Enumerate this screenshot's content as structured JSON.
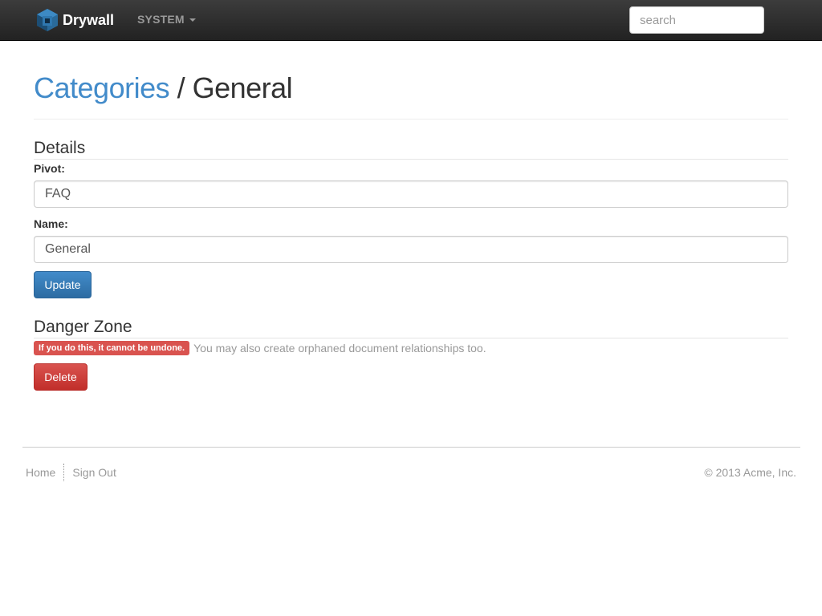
{
  "navbar": {
    "brand": "Drywall",
    "system_menu": "SYSTEM",
    "search_placeholder": "search"
  },
  "header": {
    "breadcrumb_link": "Categories",
    "separator": " / ",
    "current": "General"
  },
  "details": {
    "title": "Details",
    "pivot_label": "Pivot:",
    "pivot_value": "FAQ",
    "name_label": "Name:",
    "name_value": "General",
    "update_button": "Update"
  },
  "danger_zone": {
    "title": "Danger Zone",
    "warning_badge": "If you do this, it cannot be undone.",
    "warning_help": "You may also create orphaned document relationships too.",
    "delete_button": "Delete"
  },
  "footer": {
    "links": [
      "Home",
      "Sign Out"
    ],
    "copyright": "© 2013 Acme, Inc."
  },
  "colors": {
    "link": "#428bca",
    "primary": "#428bca",
    "danger": "#d9534f"
  }
}
